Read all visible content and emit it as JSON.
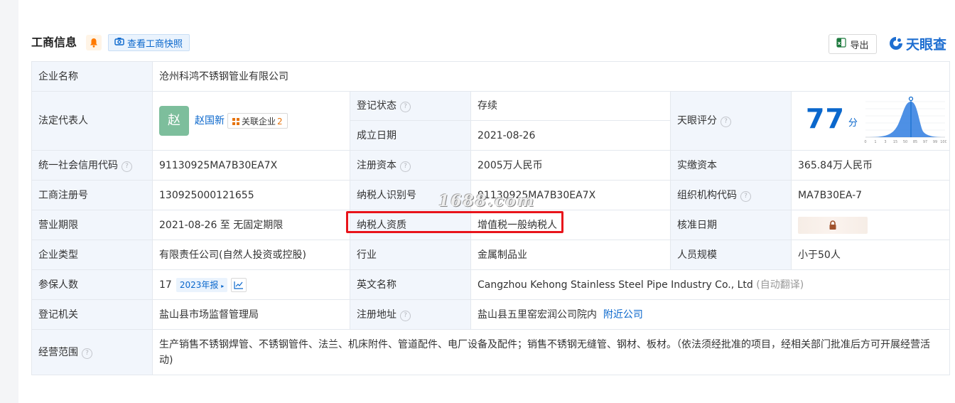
{
  "header": {
    "title": "工商信息",
    "snapshot_label": "查看工商快照",
    "export_label": "导出",
    "logo_text": "天眼查"
  },
  "rows": {
    "company_name": {
      "label": "企业名称",
      "value": "沧州科鸿不锈钢管业有限公司"
    },
    "legal_rep": {
      "label": "法定代表人",
      "avatar": "赵",
      "name": "赵国新",
      "related_label": "关联企业",
      "related_count": "2"
    },
    "reg_status": {
      "label": "登记状态",
      "value": "存续"
    },
    "est_date": {
      "label": "成立日期",
      "value": "2021-08-26"
    },
    "tianyan_score": {
      "label": "天眼评分",
      "score": "77",
      "unit": "分"
    },
    "credit_code": {
      "label": "统一社会信用代码",
      "value": "91130925MA7B30EA7X"
    },
    "reg_capital": {
      "label": "注册资本",
      "value": "2005万人民币"
    },
    "paid_capital": {
      "label": "实缴资本",
      "value": "365.84万人民币"
    },
    "biz_reg_no": {
      "label": "工商注册号",
      "value": "130925000121655"
    },
    "taxpayer_id": {
      "label": "纳税人识别号",
      "value": "91130925MA7B30EA7X"
    },
    "org_code": {
      "label": "组织机构代码",
      "value": "MA7B30EA-7"
    },
    "biz_term": {
      "label": "营业期限",
      "value": "2021-08-26 至 无固定期限"
    },
    "taxpayer_qual": {
      "label": "纳税人资质",
      "value": "增值税一般纳税人"
    },
    "approval_date": {
      "label": "核准日期"
    },
    "company_type": {
      "label": "企业类型",
      "value": "有限责任公司(自然人投资或控股)"
    },
    "industry": {
      "label": "行业",
      "value": "金属制品业"
    },
    "staff_size": {
      "label": "人员规模",
      "value": "小于50人"
    },
    "insured": {
      "label": "参保人数",
      "value": "17",
      "year_badge": "2023年报"
    },
    "english_name": {
      "label": "英文名称",
      "value": "Cangzhou Kehong Stainless Steel Pipe Industry Co., Ltd",
      "note": "(自动翻译)"
    },
    "reg_authority": {
      "label": "登记机关",
      "value": "盐山县市场监督管理局"
    },
    "reg_address": {
      "label": "注册地址",
      "value": "盐山县五里窑宏润公司院内",
      "nearby": "附近公司"
    },
    "biz_scope": {
      "label": "经营范围",
      "value": "生产销售不锈钢焊管、不锈钢管件、法兰、机床附件、管道配件、电厂设备及配件；销售不锈钢无缝管、钢材、板材。（依法须经批准的项目，经相关部门批准后方可开展经营活动)"
    }
  },
  "score_axis": [
    "0",
    "1",
    "3",
    "15",
    "50",
    "85",
    "97",
    "99",
    "100"
  ],
  "watermark": "1688.com",
  "colors": {
    "accent": "#0a67cc",
    "status_green": "#16a34a",
    "highlight_red": "#e8141b",
    "label_bg": "#f2f6fc"
  }
}
